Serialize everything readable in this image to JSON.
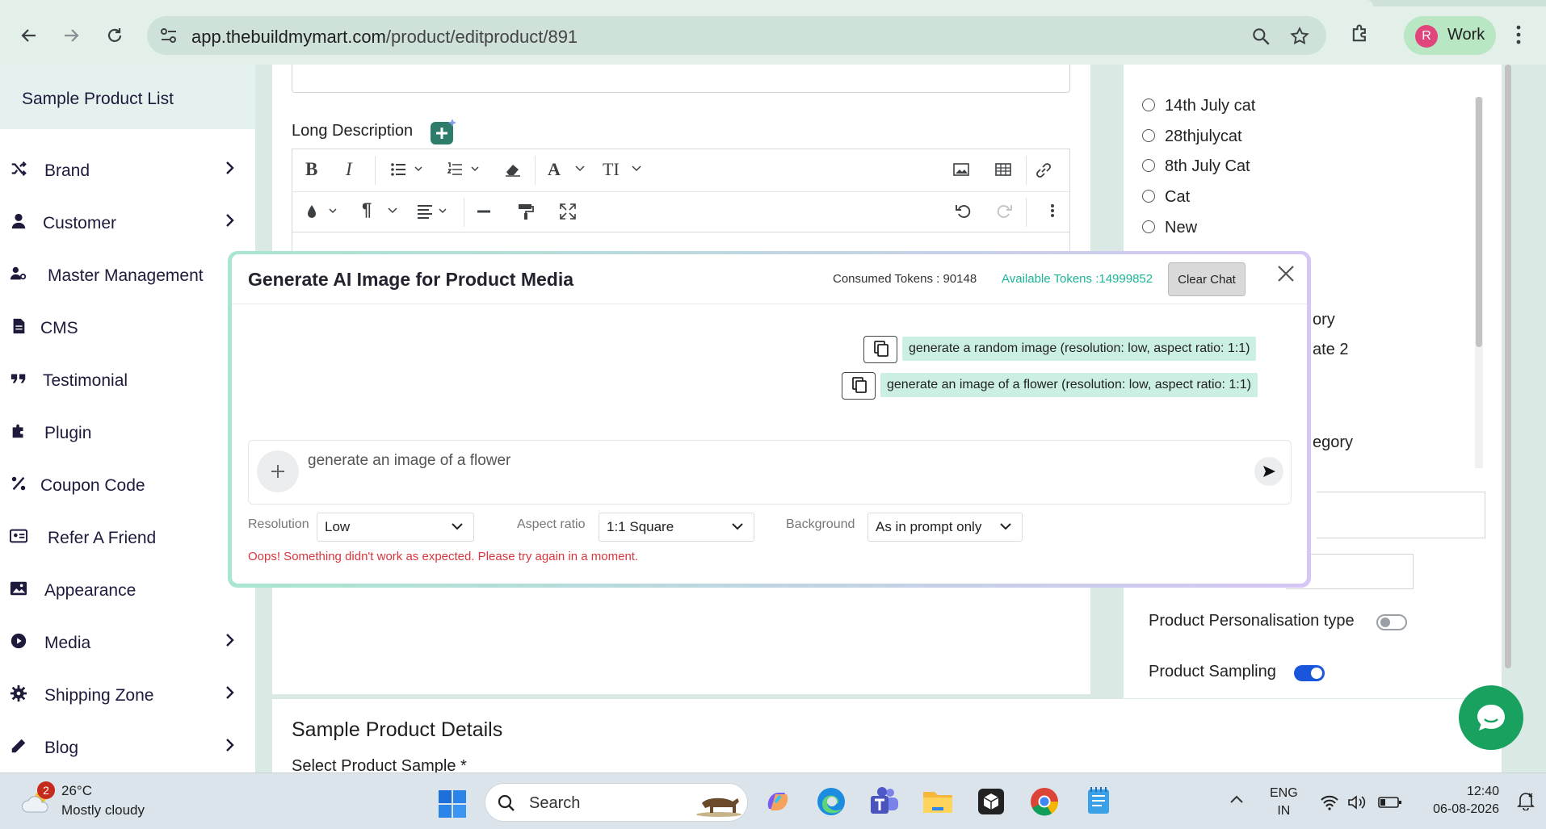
{
  "browser": {
    "url_host": "app.thebuildmymart.com",
    "url_path": "/product/editproduct/891",
    "profile_initial": "R",
    "profile_label": "Work"
  },
  "sidebar": {
    "header": "Sample Product List",
    "items": [
      {
        "label": "Brand",
        "icon": "shuffle-icon",
        "has_chevron": true
      },
      {
        "label": "Customer",
        "icon": "user-icon",
        "has_chevron": true
      },
      {
        "label": "Master Management",
        "icon": "users-gear-icon",
        "has_chevron": true
      },
      {
        "label": "CMS",
        "icon": "file-icon",
        "has_chevron": false
      },
      {
        "label": "Testimonial",
        "icon": "quote-icon",
        "has_chevron": false
      },
      {
        "label": "Plugin",
        "icon": "puzzle-icon",
        "has_chevron": false
      },
      {
        "label": "Coupon Code",
        "icon": "percent-icon",
        "has_chevron": false
      },
      {
        "label": "Refer A Friend",
        "icon": "id-card-icon",
        "has_chevron": false
      },
      {
        "label": "Appearance",
        "icon": "image-icon",
        "has_chevron": true
      },
      {
        "label": "Media",
        "icon": "play-circle-icon",
        "has_chevron": true
      },
      {
        "label": "Shipping Zone",
        "icon": "gear-icon",
        "has_chevron": true
      },
      {
        "label": "Blog",
        "icon": "pencil-icon",
        "has_chevron": true
      }
    ]
  },
  "editor": {
    "long_description_label": "Long Description"
  },
  "categories": {
    "items": [
      "14th July cat",
      "28thjulycat",
      "8th July Cat",
      "Cat",
      "New"
    ],
    "partial_1": "ory",
    "partial_2": "ate 2",
    "partial_3": "egory"
  },
  "toggles": {
    "personalisation_label": "Product Personalisation type",
    "personalisation_on": false,
    "sampling_label": "Product Sampling",
    "sampling_on": true
  },
  "sample_section": {
    "title": "Sample Product Details",
    "subtitle": "Select Product Sample *"
  },
  "modal": {
    "title": "Generate AI Image for Product Media",
    "consumed_tokens": "Consumed Tokens : 90148",
    "available_tokens": "Available Tokens :14999852",
    "clear_chat": "Clear Chat",
    "messages": [
      "generate a random image (resolution: low, aspect ratio: 1:1)",
      "generate an image of a flower (resolution: low, aspect ratio: 1:1)"
    ],
    "prompt_value": "generate an image of a flower",
    "resolution_label": "Resolution",
    "resolution_value": "Low",
    "aspect_label": "Aspect ratio",
    "aspect_value": "1:1 Square",
    "background_label": "Background",
    "background_value": "As in prompt only",
    "error": "Oops! Something didn't work as expected. Please try again in a moment."
  },
  "taskbar": {
    "weather_badge": "2",
    "weather_temp": "26°C",
    "weather_desc": "Mostly cloudy",
    "search_label": "Search",
    "lang_line1": "ENG",
    "lang_line2": "IN",
    "time": "12:40",
    "date": "06-08-2026"
  },
  "colors": {
    "accent_green": "#1bb596",
    "error_red": "#d9363e",
    "toggle_blue": "#1a56db",
    "chat_green": "#19a15f"
  }
}
